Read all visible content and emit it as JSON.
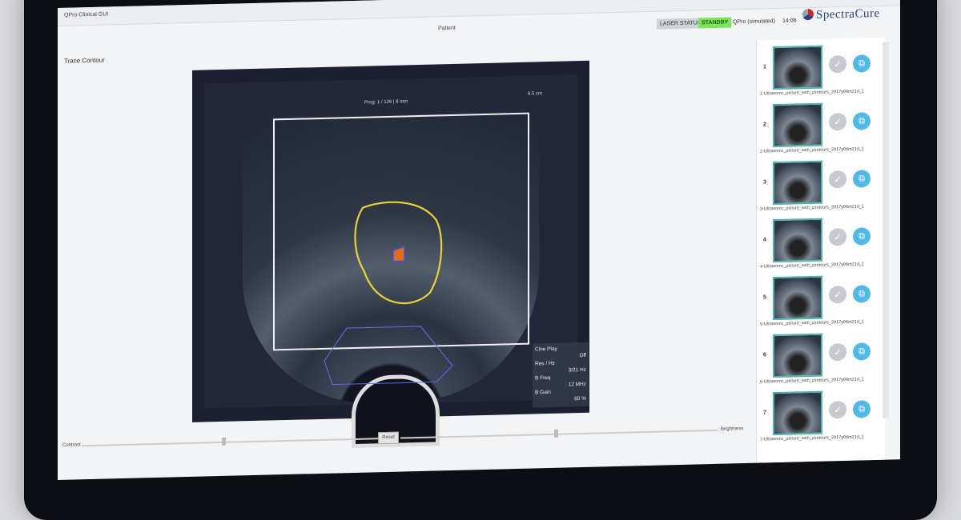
{
  "window": {
    "app_title": "QPro Clinical GUI",
    "patient_label": "Patient",
    "page_title": "Trace Contour",
    "laser_status_label": "LASER STATUS",
    "laser_status_value": "STANDBY",
    "device_label": "QPro (simulated)",
    "time": "14:06",
    "brand": "SpectraCure"
  },
  "viewer": {
    "scale_label": "Prog: 1 / 126 | 8 mm",
    "depth_label": "6.5 cm",
    "cine": {
      "title": "Cine Play",
      "state": "Off",
      "res_label": "Res / Hz",
      "res_value": "3/21 Hz",
      "bfreq_label": "B Freq",
      "bfreq_value": "12 MHz",
      "bgain_label": "B Gain",
      "bgain_value": "60 %"
    }
  },
  "controls": {
    "contrast_label": "Contrast",
    "reset_label": "Reset",
    "brightness_label": "Brightness"
  },
  "thumbnails": [
    {
      "num": "1",
      "name": "1-Ultrasonic_picture_with_contours_2017y04m21d_1"
    },
    {
      "num": "2",
      "name": "2-Ultrasonic_picture_with_contours_2017y04m21d_1"
    },
    {
      "num": "3",
      "name": "3-Ultrasonic_picture_with_contours_2017y04m21d_1"
    },
    {
      "num": "4",
      "name": "4-Ultrasonic_picture_with_contours_2017y04m21d_1"
    },
    {
      "num": "5",
      "name": "5-Ultrasonic_picture_with_contours_2017y04m21d_1"
    },
    {
      "num": "6",
      "name": "6-Ultrasonic_picture_with_contours_2017y04m21d_1"
    },
    {
      "num": "7",
      "name": "7-Ultrasonic_picture_with_contours_2017y04m21d_1"
    }
  ],
  "colors": {
    "accent": "#51b8e8",
    "contour": "#e8d23a",
    "status_ok": "#7be65a",
    "brand": "#2c3f8f"
  }
}
